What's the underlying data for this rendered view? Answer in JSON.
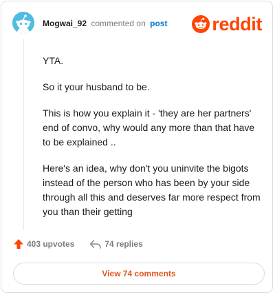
{
  "comment": {
    "username": "Mogwai_92",
    "commented_text": "commented on",
    "post_link": "post",
    "body": [
      "YTA.",
      "So it your husband to be.",
      "This is how you explain it - 'they are her partners' end of convo, why would any more than that have to be explained ..",
      "Here's an idea, why don't you uninvite the bigots instead of the person who has been by your side through all this and deserves far more respect from you than their getting"
    ]
  },
  "brand": {
    "wordmark": "reddit",
    "color": "#ff4500"
  },
  "actions": {
    "upvotes": "403 upvotes",
    "replies": "74 replies",
    "upvote_icon": "upvote-arrow-icon",
    "reply_icon": "reply-arrow-icon"
  },
  "footer": {
    "view_comments": "View 74 comments"
  },
  "colors": {
    "avatar": "#4fbde2",
    "upvote": "#ff4500",
    "link": "#0079d3",
    "button_text": "#e2571e"
  }
}
